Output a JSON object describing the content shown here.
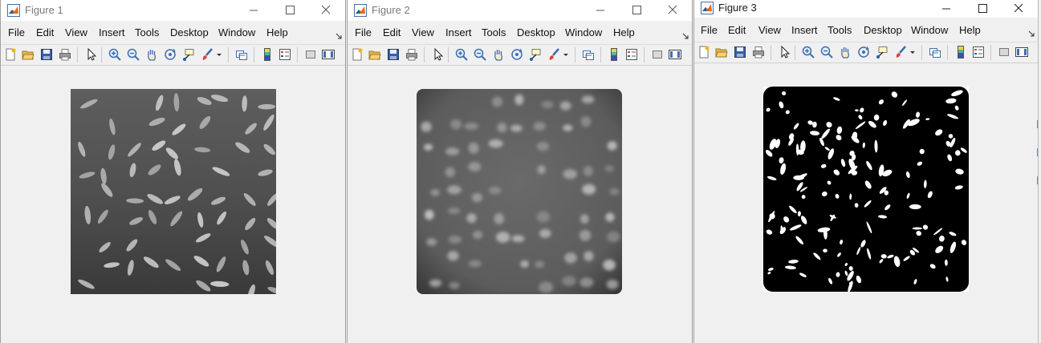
{
  "windows": [
    {
      "title": "Figure 1",
      "menus": [
        "File",
        "Edit",
        "View",
        "Insert",
        "Tools",
        "Desktop",
        "Window",
        "Help"
      ]
    },
    {
      "title": "Figure 2",
      "menus": [
        "File",
        "Edit",
        "View",
        "Insert",
        "Tools",
        "Desktop",
        "Window",
        "Help"
      ]
    },
    {
      "title": "Figure 3",
      "menus": [
        "File",
        "Edit",
        "View",
        "Insert",
        "Tools",
        "Desktop",
        "Window",
        "Help"
      ]
    }
  ],
  "toolbar_icons": [
    "new-figure-icon",
    "open-file-icon",
    "save-icon",
    "print-icon",
    "edit-plot-icon",
    "zoom-in-icon",
    "zoom-out-icon",
    "pan-icon",
    "rotate-3d-icon",
    "data-cursor-icon",
    "brush-icon",
    "link-plot-icon",
    "colorbar-icon",
    "legend-icon",
    "hide-plot-tools-icon",
    "show-plot-tools-icon"
  ],
  "images": [
    {
      "name": "original-rice-image",
      "description": "grayscale"
    },
    {
      "name": "background-subtracted-image",
      "description": "grayscale"
    },
    {
      "name": "binary-mask-image",
      "description": "black-white"
    }
  ],
  "colors": {
    "matlab_orange": "#e46b1f",
    "matlab_blue": "#1f5fa8",
    "close_hover": "#e81123"
  }
}
